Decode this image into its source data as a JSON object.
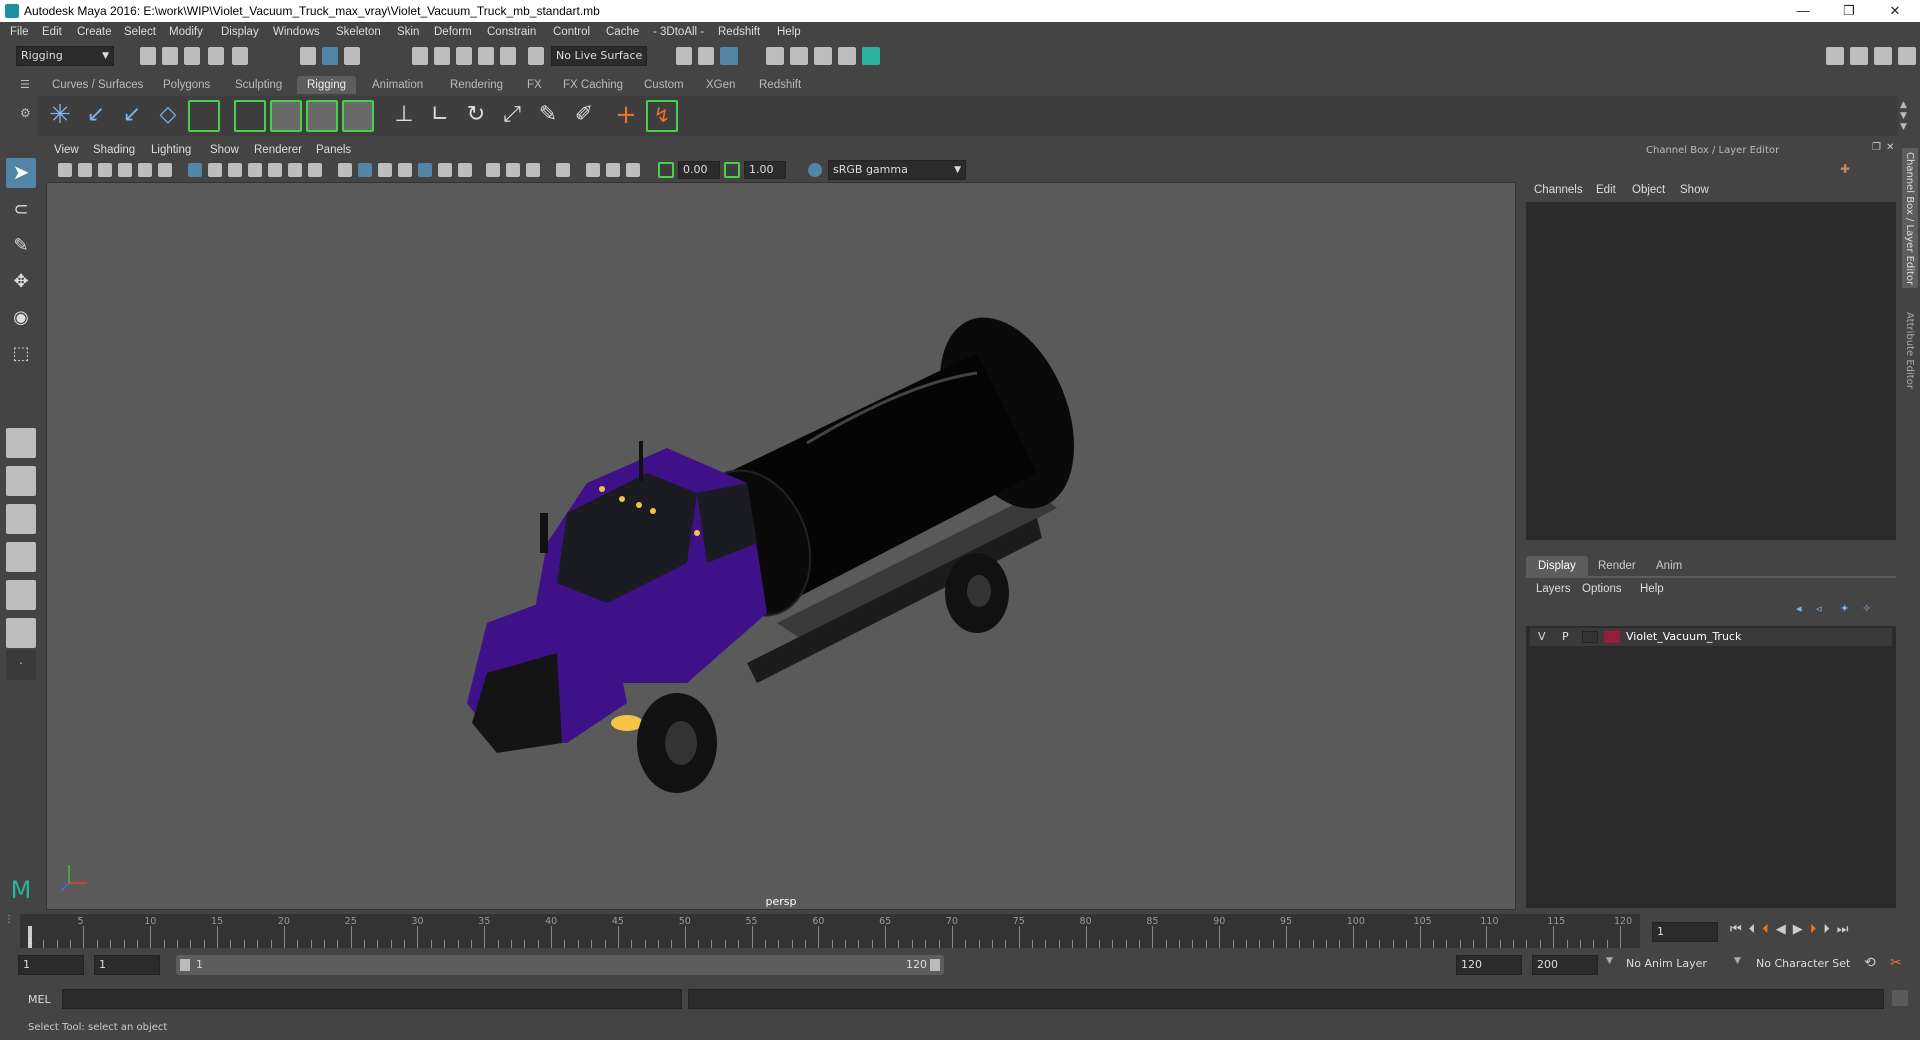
{
  "window": {
    "title": "Autodesk Maya 2016: E:\\work\\WIP\\Violet_Vacuum_Truck_max_vray\\Violet_Vacuum_Truck_mb_standart.mb",
    "minimize": "—",
    "maximize": "❐",
    "close": "✕"
  },
  "menubar": [
    "File",
    "Edit",
    "Create",
    "Select",
    "Modify",
    "Display",
    "Windows",
    "Skeleton",
    "Skin",
    "Deform",
    "Constrain",
    "Control",
    "Cache",
    "- 3DtoAll -",
    "Redshift",
    "Help"
  ],
  "statusline": {
    "mode": "Rigging",
    "live_surface": "No Live Surface"
  },
  "shelf_tabs": [
    "Curves / Surfaces",
    "Polygons",
    "Sculpting",
    "Rigging",
    "Animation",
    "Rendering",
    "FX",
    "FX Caching",
    "Custom",
    "XGen",
    "Redshift"
  ],
  "active_shelf_tab": "Rigging",
  "viewport": {
    "menu": [
      "View",
      "Shading",
      "Lighting",
      "Show",
      "Renderer",
      "Panels"
    ],
    "exposure": "0.00",
    "gamma": "1.00",
    "color_space": "sRGB gamma",
    "camera": "persp"
  },
  "channel_box": {
    "title": "Channel Box / Layer Editor",
    "menu": [
      "Channels",
      "Edit",
      "Object",
      "Show"
    ],
    "layer_tabs": [
      "Display",
      "Render",
      "Anim"
    ],
    "active_layer_tab": "Display",
    "layer_menu": [
      "Layers",
      "Options",
      "Help"
    ],
    "layers": [
      {
        "v": "V",
        "p": "P",
        "name": "Violet_Vacuum_Truck",
        "color": "#9b1c3a"
      }
    ]
  },
  "side_tabs": [
    "Channel Box / Layer Editor",
    "Attribute Editor"
  ],
  "timeline": {
    "ticks": [
      5,
      10,
      15,
      20,
      25,
      30,
      35,
      40,
      45,
      50,
      55,
      60,
      65,
      70,
      75,
      80,
      85,
      90,
      95,
      100,
      105,
      110,
      115,
      120
    ],
    "start_label": "1",
    "current_frame": "1"
  },
  "range": {
    "start": "1",
    "playback_start": "1",
    "range_start_label": "1",
    "range_end_label": "120",
    "playback_end": "120",
    "end": "200",
    "anim_layer": "No Anim Layer",
    "character_set": "No Character Set"
  },
  "command_line": {
    "lang": "MEL"
  },
  "help_line": "Select Tool: select an object",
  "colors": {
    "truck_cab": "#3e1189",
    "tank": "#050505",
    "accent": "#5285a6"
  }
}
